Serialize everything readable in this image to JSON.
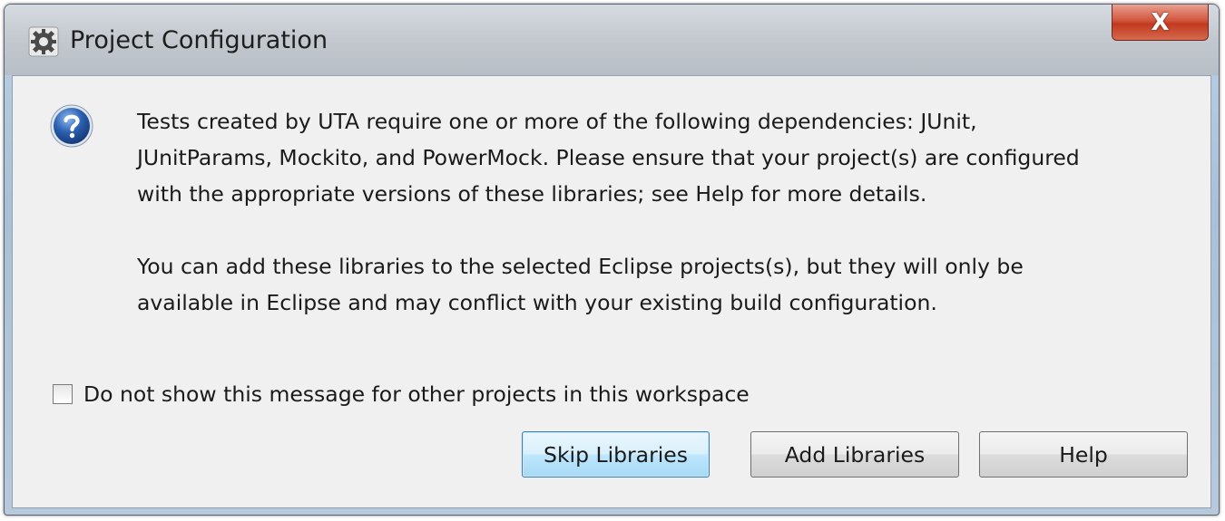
{
  "window": {
    "title": "Project Configuration",
    "close_glyph": "X"
  },
  "icons": {
    "app": "eclipse-gear-icon",
    "message": "question-icon",
    "close": "close-icon"
  },
  "message": {
    "paragraph1": "Tests created by UTA require one or more of the following dependencies: JUnit,\nJUnitParams, Mockito, and PowerMock. Please ensure that your project(s) are configured\nwith the appropriate versions of these libraries; see Help for more details.",
    "paragraph2": "You can add these libraries to the selected Eclipse projects(s), but they will only be\navailable in Eclipse and may conflict with your existing build configuration."
  },
  "checkbox": {
    "label": "Do not show this message for other projects in this workspace",
    "checked": false
  },
  "buttons": {
    "skip": "Skip Libraries",
    "add": "Add Libraries",
    "help": "Help"
  },
  "colors": {
    "close_button": "#c2391f",
    "question_icon": "#2a5fb0",
    "default_button_border": "#3c7fb1"
  }
}
